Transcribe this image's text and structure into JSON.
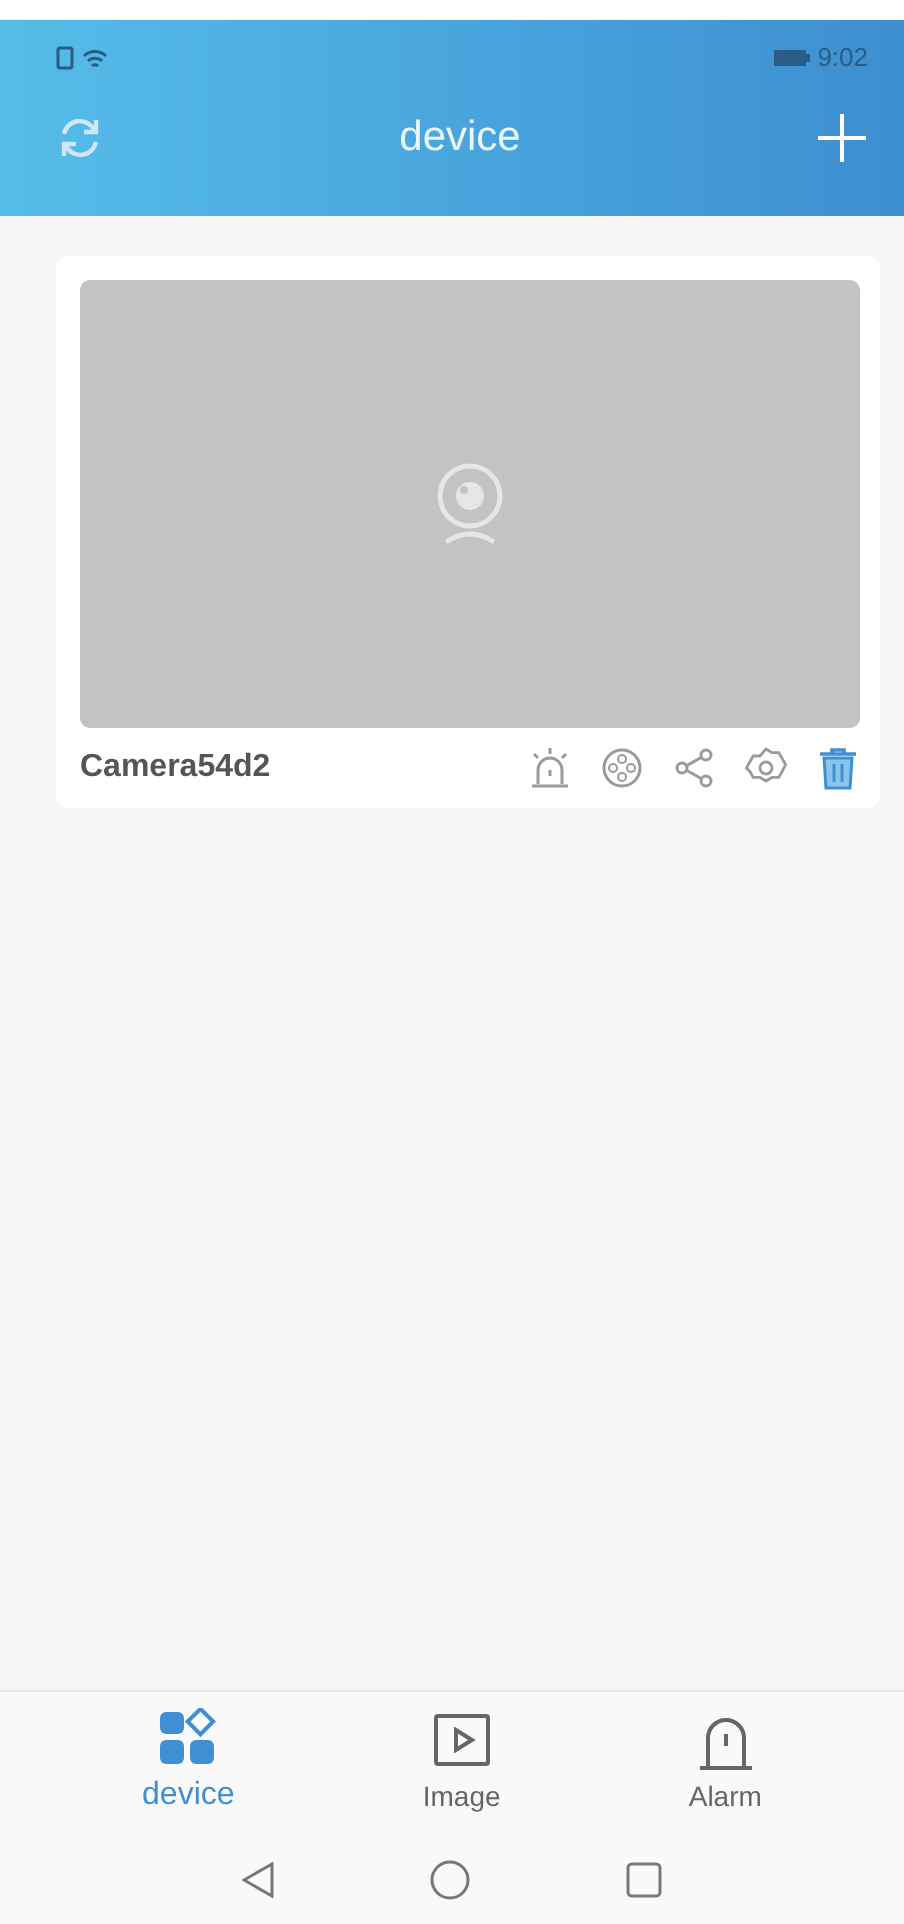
{
  "status_bar": {
    "time": "9:02"
  },
  "header": {
    "title": "device"
  },
  "devices": [
    {
      "name": "Camera54d2"
    }
  ],
  "tabs": [
    {
      "label": "device",
      "kind": "device",
      "selected": true
    },
    {
      "label": "Image",
      "kind": "image",
      "selected": false
    },
    {
      "label": "Alarm",
      "kind": "alarm",
      "selected": false
    }
  ]
}
